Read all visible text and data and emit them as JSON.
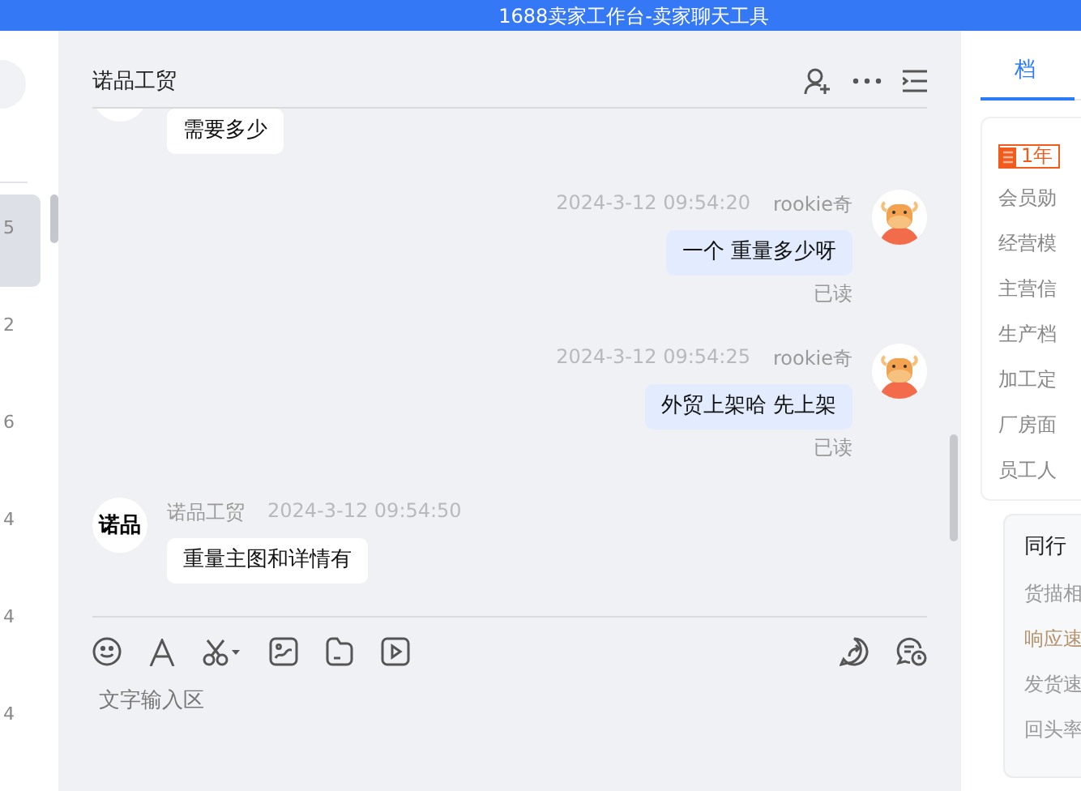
{
  "window": {
    "title": "1688卖家工作台-卖家聊天工具"
  },
  "conversation_list": {
    "items": [
      {
        "count": "5",
        "selected": true
      },
      {
        "count": "2",
        "selected": false
      },
      {
        "count": "6",
        "selected": false
      },
      {
        "count": "4",
        "selected": false
      },
      {
        "count": "4",
        "selected": false
      },
      {
        "count": "4",
        "selected": false
      }
    ]
  },
  "chat": {
    "title": "诺品工贸",
    "messages": [
      {
        "kind": "received",
        "text": "需要多少"
      },
      {
        "kind": "sent",
        "time": "2024-3-12 09:54:20",
        "sender": "rookie奇",
        "text": "一个 重量多少呀",
        "status": "已读"
      },
      {
        "kind": "sent",
        "time": "2024-3-12 09:54:25",
        "sender": "rookie奇",
        "text": "外贸上架哈 先上架",
        "status": "已读"
      },
      {
        "kind": "received",
        "avatar_text": "诺品",
        "sender": "诺品工贸",
        "time": "2024-3-12 09:54:50",
        "text": "重量主图和详情有"
      }
    ],
    "input": {
      "placeholder": "文字输入区"
    }
  },
  "profile_panel": {
    "tab": "档",
    "badge": "1年",
    "rows": [
      "会员勋",
      "经营模",
      "主营信",
      "生产档",
      "加工定",
      "厂房面",
      "员工人"
    ],
    "peer_card": {
      "title": "同行",
      "items": [
        {
          "label": "货描相",
          "highlighted": false
        },
        {
          "label": "响应速",
          "highlighted": true
        },
        {
          "label": "发货速",
          "highlighted": false
        },
        {
          "label": "回头率",
          "highlighted": false
        }
      ]
    }
  }
}
